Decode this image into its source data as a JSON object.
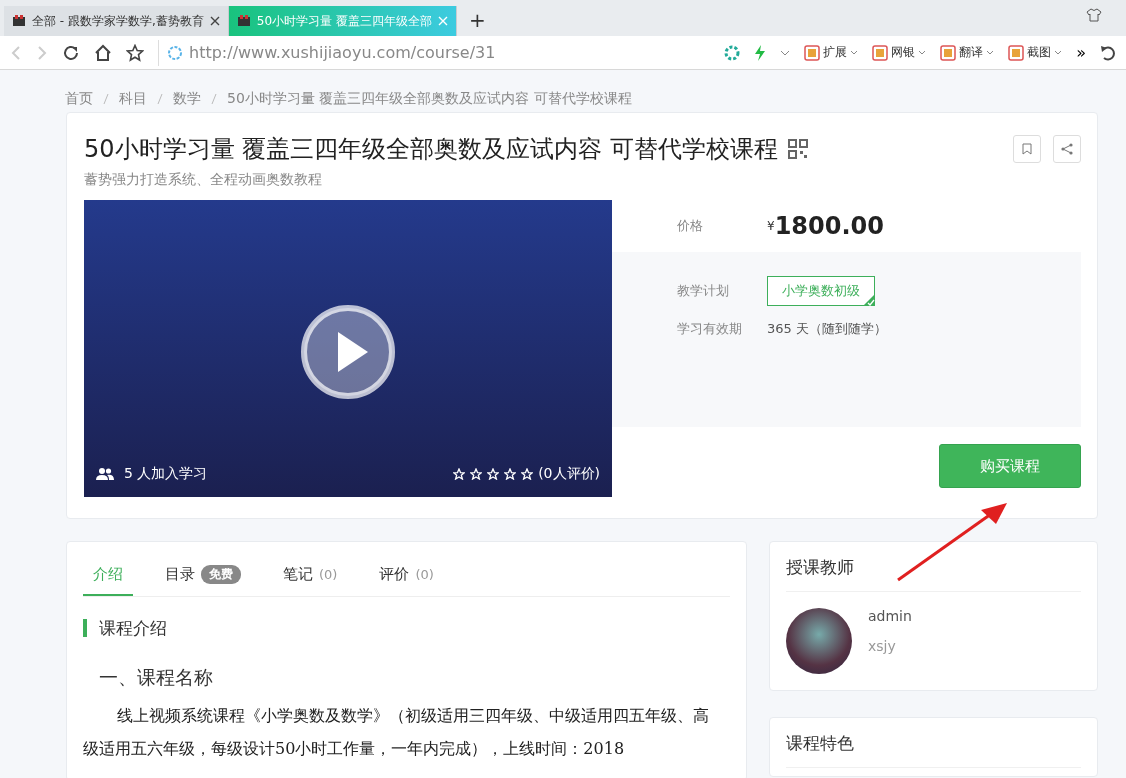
{
  "browser": {
    "tabs": [
      {
        "title": "全部 - 跟数学家学数学,蓄势教育",
        "selected": false
      },
      {
        "title": "50小时学习量 覆盖三四年级全部",
        "selected": true
      }
    ],
    "new_tab": "+",
    "address": "http://www.xushijiaoyu.com/course/31",
    "toolbar": [
      {
        "label": "扩展"
      },
      {
        "label": "网银"
      },
      {
        "label": "翻译"
      },
      {
        "label": "截图"
      }
    ],
    "more": "»"
  },
  "breadcrumb": [
    "首页",
    "科目",
    "数学",
    "50小时学习量 覆盖三四年级全部奥数及应试内容 可替代学校课程"
  ],
  "course": {
    "title": "50小时学习量 覆盖三四年级全部奥数及应试内容 可替代学校课程",
    "subtitle": "蓄势强力打造系统、全程动画奥数教程",
    "learners": "5 人加入学习",
    "stars": 0,
    "reviews": "(0人评价)",
    "price_label": "价格",
    "currency": "¥",
    "price": "1800.00",
    "plan_label": "教学计划",
    "plans": [
      {
        "label": "小学奥数初级",
        "selected": true
      }
    ],
    "validity_label": "学习有效期",
    "validity": "365 天（随到随学）",
    "buy": "购买课程"
  },
  "tabs": [
    {
      "label": "介绍",
      "selected": true
    },
    {
      "label": "目录",
      "badge": "免费",
      "selected": false
    },
    {
      "label": "笔记",
      "count": "(0)",
      "selected": false
    },
    {
      "label": "评价",
      "count": "(0)",
      "selected": false
    }
  ],
  "intro": {
    "heading": "课程介绍",
    "subheading": "一、课程名称",
    "paragraph": "线上视频系统课程《小学奥数及数学》（初级适用三四年级、中级适用四五年级、高级适用五六年级，每级设计50小时工作量，一年内完成），上线时间：2018"
  },
  "teacher": {
    "title": "授课教师",
    "name": "admin",
    "org": "xsjy"
  },
  "features": {
    "title": "课程特色"
  }
}
